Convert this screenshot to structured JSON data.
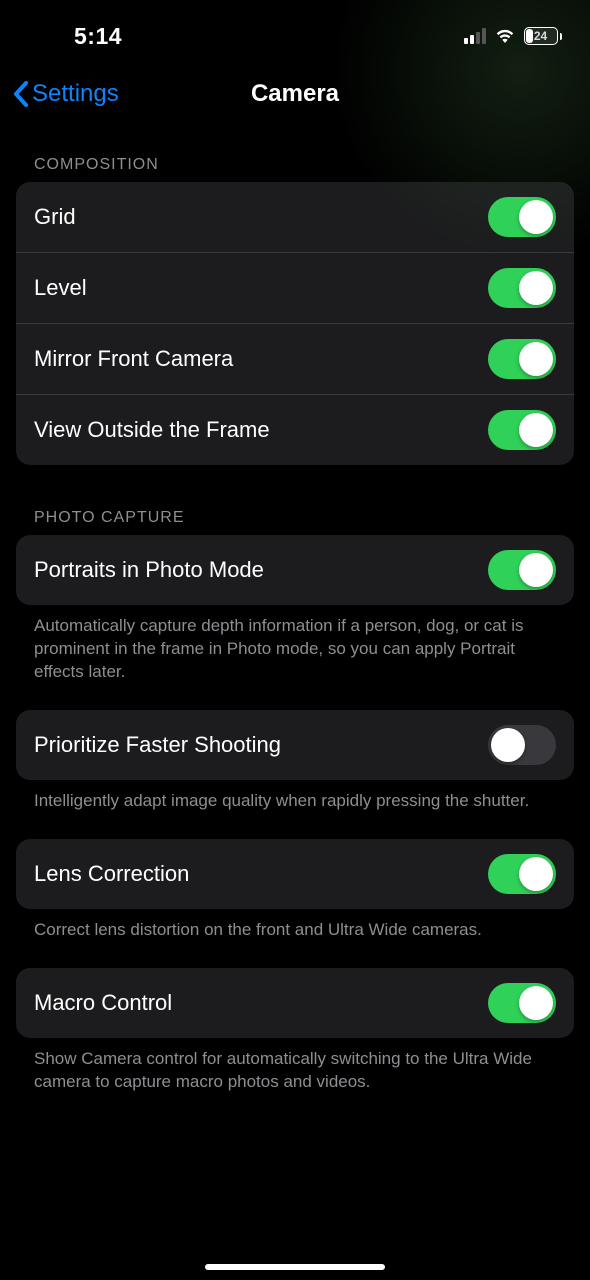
{
  "status": {
    "time": "5:14",
    "battery_pct": "24"
  },
  "nav": {
    "back_label": "Settings",
    "title": "Camera"
  },
  "sections": {
    "composition": {
      "header": "Composition",
      "rows": {
        "grid": {
          "label": "Grid",
          "on": true
        },
        "level": {
          "label": "Level",
          "on": true
        },
        "mirror": {
          "label": "Mirror Front Camera",
          "on": true
        },
        "outside": {
          "label": "View Outside the Frame",
          "on": true
        }
      }
    },
    "photo_capture": {
      "header": "Photo Capture",
      "portraits": {
        "label": "Portraits in Photo Mode",
        "on": true,
        "footer": "Automatically capture depth information if a person, dog, or cat is prominent in the frame in Photo mode, so you can apply Portrait effects later."
      },
      "prioritize": {
        "label": "Prioritize Faster Shooting",
        "on": false,
        "footer": "Intelligently adapt image quality when rapidly pressing the shutter."
      },
      "lens": {
        "label": "Lens Correction",
        "on": true,
        "footer": "Correct lens distortion on the front and Ultra Wide cameras."
      },
      "macro": {
        "label": "Macro Control",
        "on": true,
        "footer": "Show Camera control for automatically switching to the Ultra Wide camera to capture macro photos and videos."
      }
    }
  }
}
